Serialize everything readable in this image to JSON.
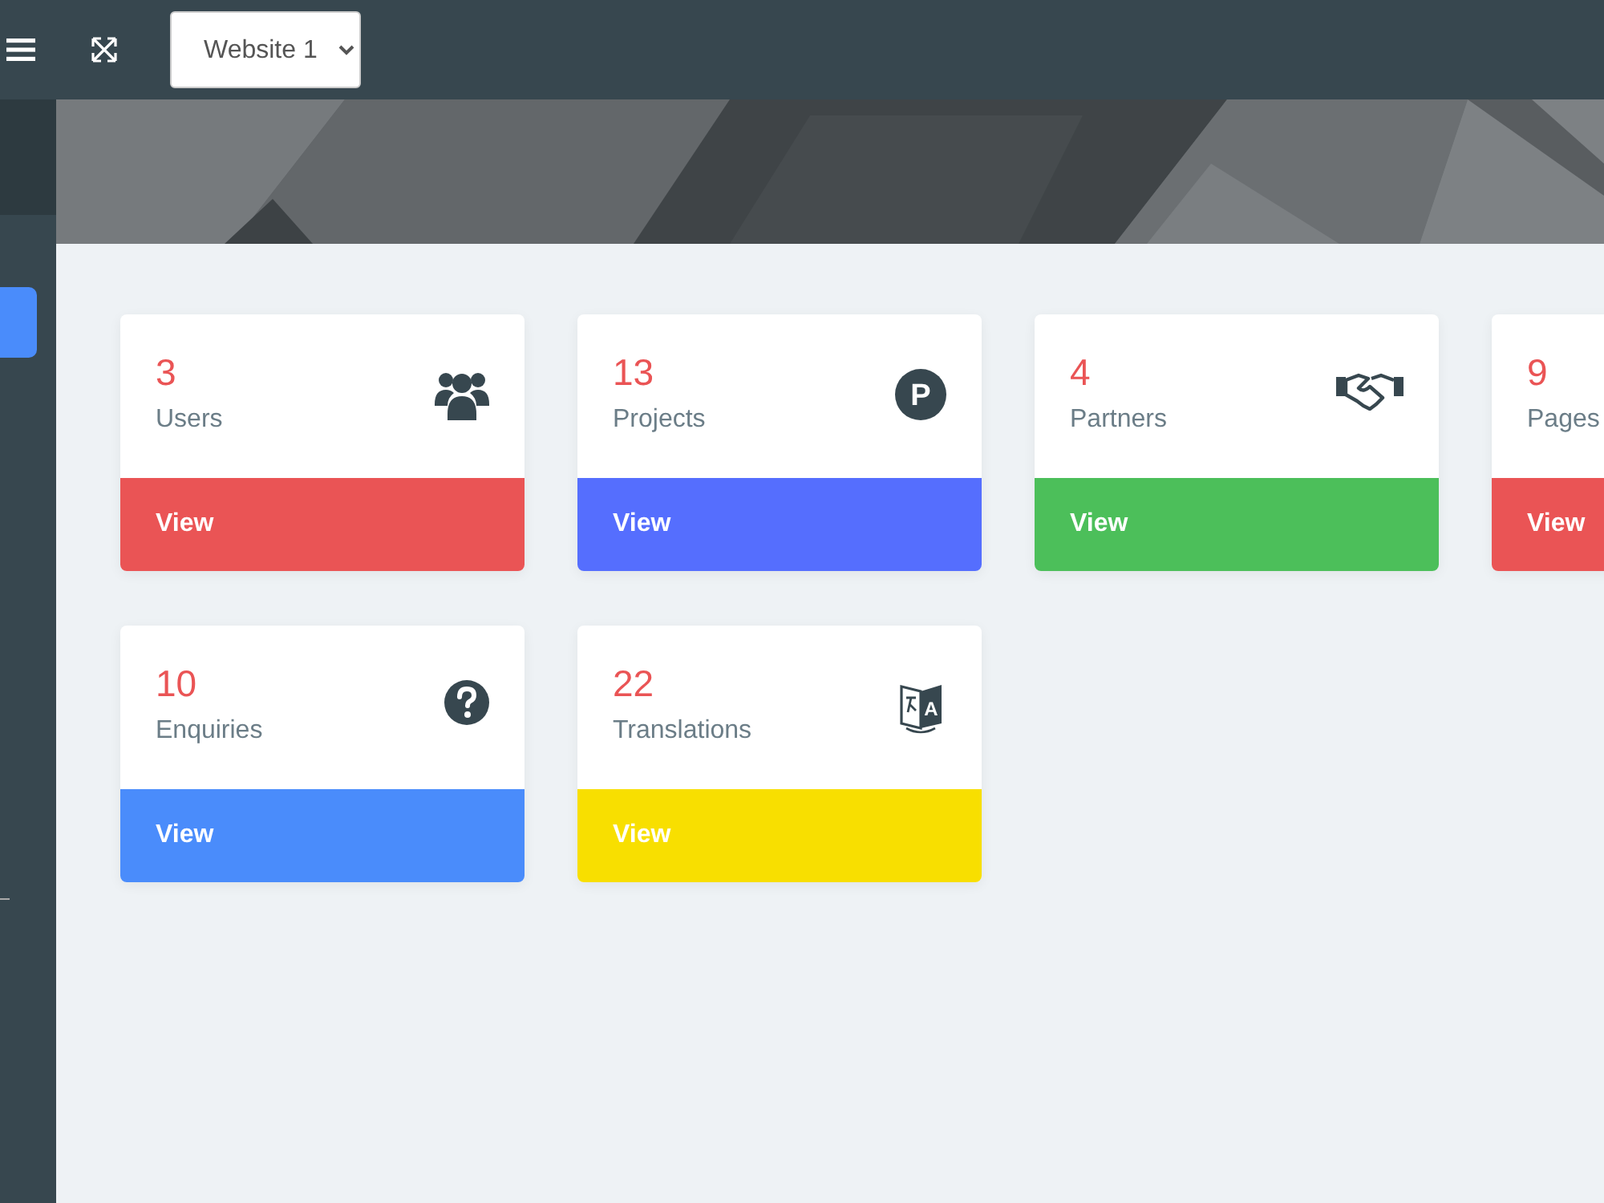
{
  "topbar": {
    "site_select": {
      "value": "Website 1"
    }
  },
  "cards": [
    {
      "count": "3",
      "label": "Users",
      "kind": "users",
      "action": "View",
      "color": "#ea5455"
    },
    {
      "count": "13",
      "label": "Projects",
      "kind": "letter-circle",
      "icon_letter": "P",
      "action": "View",
      "color": "#556efe"
    },
    {
      "count": "4",
      "label": "Partners",
      "kind": "handshake",
      "action": "View",
      "color": "#4cbf5a"
    },
    {
      "count": "9",
      "label": "Pages",
      "action": "View",
      "color": "#ea5455"
    },
    {
      "count": "10",
      "label": "Enquiries",
      "kind": "question",
      "action": "View",
      "color": "#4a8cfb"
    },
    {
      "count": "22",
      "label": "Translations",
      "kind": "translate",
      "icon_letter": "A",
      "action": "View",
      "color": "#f8df00"
    }
  ]
}
